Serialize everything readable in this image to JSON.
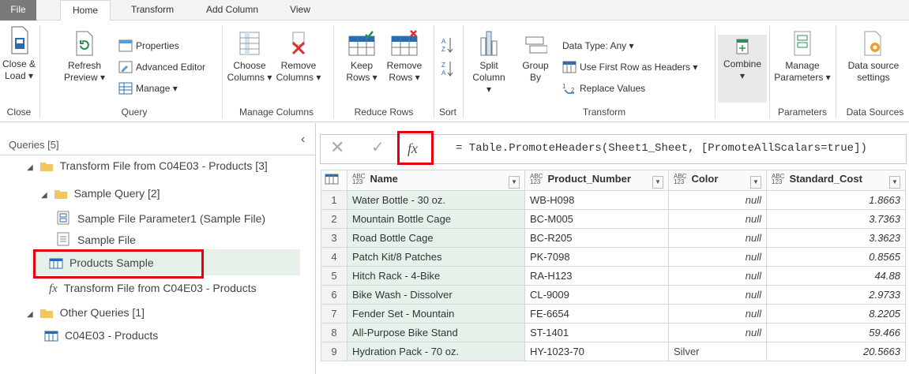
{
  "tabs": [
    "File",
    "Home",
    "Transform",
    "Add Column",
    "View"
  ],
  "ribbon": {
    "close_load": [
      "Close &",
      "Load ▾"
    ],
    "refresh_preview": [
      "Refresh",
      "Preview ▾"
    ],
    "properties": "Properties",
    "advanced_editor": "Advanced Editor",
    "manage": "Manage ▾",
    "choose_columns": [
      "Choose",
      "Columns ▾"
    ],
    "remove_columns": [
      "Remove",
      "Columns ▾"
    ],
    "keep_rows": [
      "Keep",
      "Rows ▾"
    ],
    "remove_rows": [
      "Remove",
      "Rows ▾"
    ],
    "split_column": [
      "Split",
      "Column ▾"
    ],
    "group_by": [
      "Group",
      "By"
    ],
    "data_type": "Data Type: Any ▾",
    "use_first_row": "Use First Row as Headers ▾",
    "replace_values": "Replace Values",
    "combine": [
      "Combine",
      "▾"
    ],
    "manage_parameters": [
      "Manage",
      "Parameters ▾"
    ],
    "data_source_settings": [
      "Data source",
      "settings"
    ],
    "groups": [
      "Close",
      "Query",
      "Manage Columns",
      "Reduce Rows",
      "Sort",
      "Transform",
      "Parameters",
      "Data Sources"
    ]
  },
  "queries": {
    "header": "Queries [5]",
    "items": [
      "Transform File from C04E03 - Products [3]",
      "Sample Query [2]",
      "Sample File Parameter1 (Sample File)",
      "Sample File",
      "Products Sample",
      "Transform File from C04E03 - Products",
      "Other Queries [1]",
      "C04E03 - Products"
    ]
  },
  "formula": "= Table.PromoteHeaders(Sheet1_Sheet, [PromoteAllScalars=true])",
  "grid": {
    "type_tag": [
      "ABC",
      "123"
    ],
    "columns": [
      "Name",
      "Product_Number",
      "Color",
      "Standard_Cost"
    ],
    "rows": [
      {
        "n": "1",
        "name": "Water Bottle - 30 oz.",
        "pn": "WB-H098",
        "color": "null",
        "cost": "1.8663"
      },
      {
        "n": "2",
        "name": "Mountain Bottle Cage",
        "pn": "BC-M005",
        "color": "null",
        "cost": "3.7363"
      },
      {
        "n": "3",
        "name": "Road Bottle Cage",
        "pn": "BC-R205",
        "color": "null",
        "cost": "3.3623"
      },
      {
        "n": "4",
        "name": "Patch Kit/8 Patches",
        "pn": "PK-7098",
        "color": "null",
        "cost": "0.8565"
      },
      {
        "n": "5",
        "name": "Hitch Rack - 4-Bike",
        "pn": "RA-H123",
        "color": "null",
        "cost": "44.88"
      },
      {
        "n": "6",
        "name": "Bike Wash - Dissolver",
        "pn": "CL-9009",
        "color": "null",
        "cost": "2.9733"
      },
      {
        "n": "7",
        "name": "Fender Set - Mountain",
        "pn": "FE-6654",
        "color": "null",
        "cost": "8.2205"
      },
      {
        "n": "8",
        "name": "All-Purpose Bike Stand",
        "pn": "ST-1401",
        "color": "null",
        "cost": "59.466"
      },
      {
        "n": "9",
        "name": "Hydration Pack - 70 oz.",
        "pn": "HY-1023-70",
        "color": "Silver",
        "cost": "20.5663"
      }
    ]
  }
}
